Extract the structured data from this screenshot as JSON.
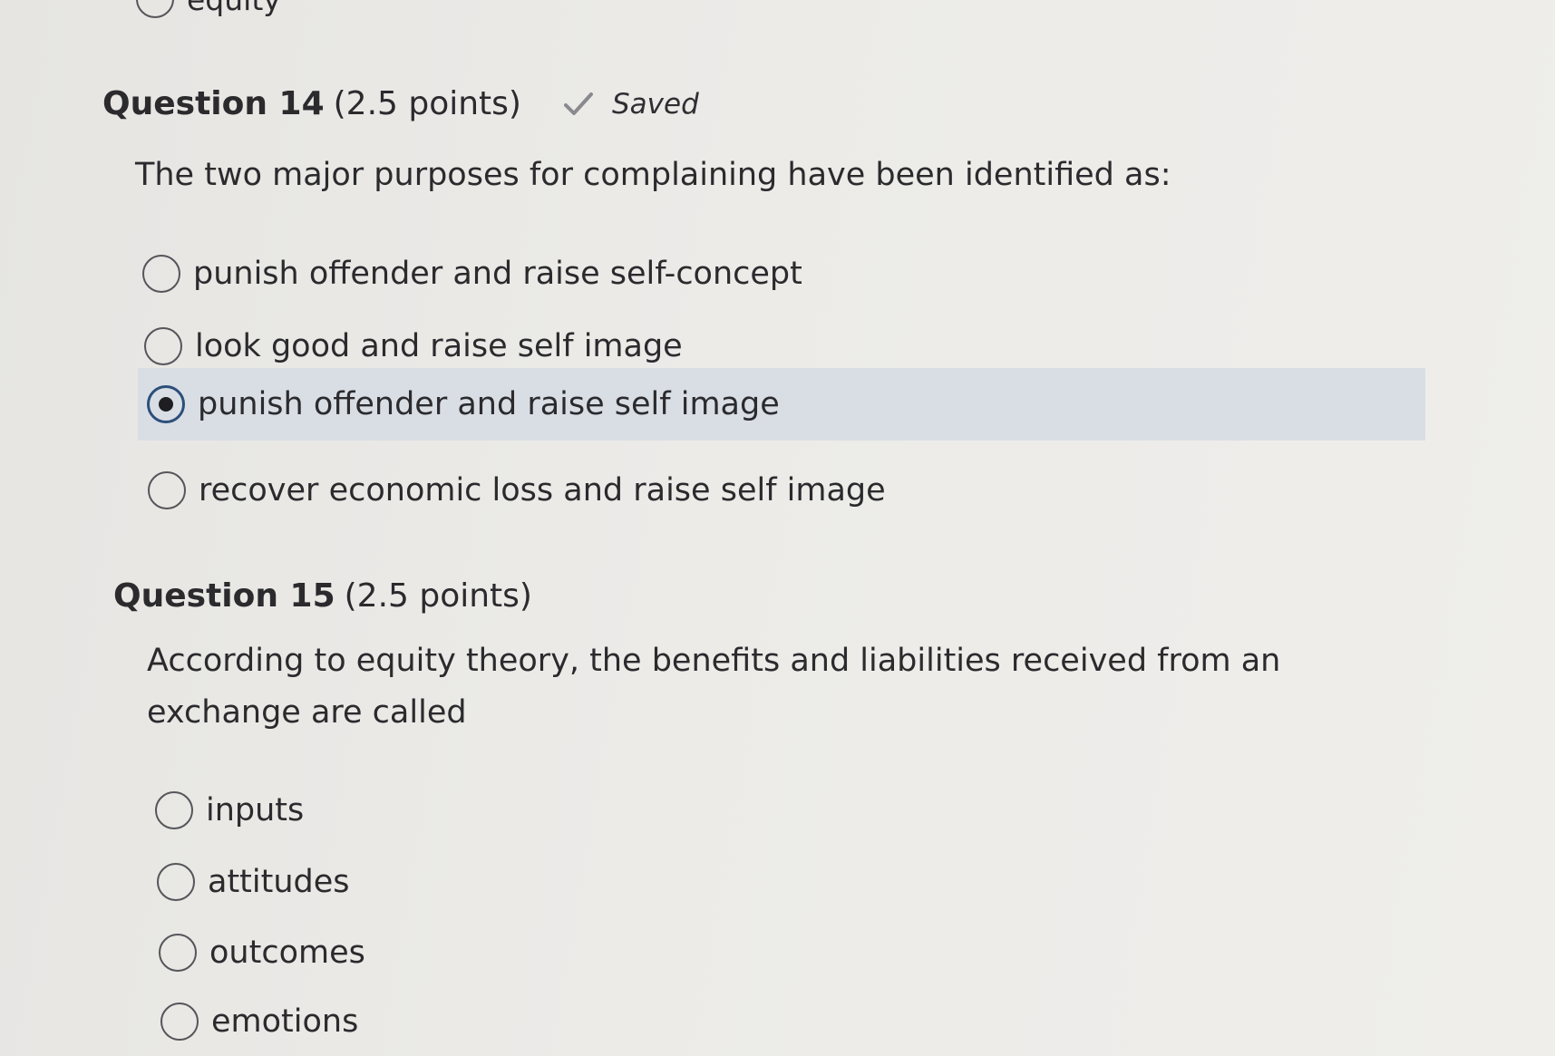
{
  "previous_question": {
    "partial_option_label": "equity"
  },
  "question14": {
    "title": "Question 14",
    "points": "(2.5 points)",
    "saved_label": "Saved",
    "text": "The two major purposes for complaining have been identified as:",
    "options": [
      {
        "label": "punish offender and raise self-concept",
        "selected": false
      },
      {
        "label": "look good and raise self image",
        "selected": false
      },
      {
        "label": "punish offender and raise self image",
        "selected": true
      },
      {
        "label": "recover economic loss and raise self image",
        "selected": false
      }
    ]
  },
  "question15": {
    "title": "Question 15",
    "points": "(2.5 points)",
    "text": "According to equity theory, the benefits and liabilities received from an exchange are called",
    "options": [
      {
        "label": "inputs",
        "selected": false
      },
      {
        "label": "attitudes",
        "selected": false
      },
      {
        "label": "outcomes",
        "selected": false
      },
      {
        "label": "emotions",
        "selected": false
      }
    ]
  },
  "colors": {
    "selected_row_bg": "#d9dee5",
    "checked_radio_ring": "#2c4f7a",
    "saved_check": "#8a8a8e"
  },
  "icons": {
    "saved": "check-icon",
    "radio": "radio-button"
  }
}
